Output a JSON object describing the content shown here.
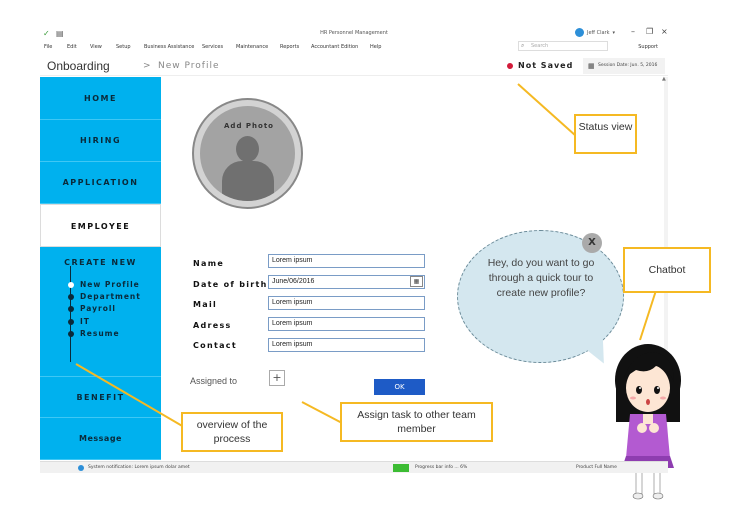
{
  "titlebar": {
    "app_title": "HR Personnel Management",
    "user_name": "Jeff Clark",
    "user_caret": "▾"
  },
  "menu": {
    "items": [
      "File",
      "Edit",
      "View",
      "Setup",
      "Business Assistance",
      "Services",
      "Maintenance",
      "Reports",
      "Accountant Edition",
      "Help"
    ],
    "search_placeholder": "Search",
    "support": "Support"
  },
  "breadcrumb": {
    "main": "Onboarding",
    "separator": ">",
    "sub": "New Profile",
    "status": "Not Saved",
    "status_color": "#d21b3a",
    "session": "Session Date: Jun. 5, 2016"
  },
  "sidebar": {
    "accent": "#00b1ee",
    "home": "HOME",
    "hiring": "HIRING",
    "application": "APPLICATION",
    "employee": "EMPLOYEE",
    "create_new": "CREATE NEW",
    "sub_items": [
      "New Profile",
      "Department",
      "Payroll",
      "IT",
      "Resume"
    ],
    "benefit": "BENEFIT",
    "message": "Message"
  },
  "form": {
    "add_photo": "Add Photo",
    "fields": [
      {
        "label": "Name",
        "value": "Lorem ipsum"
      },
      {
        "label": "Date of birth",
        "value": "June/06/2016"
      },
      {
        "label": "Mail",
        "value": "Lorem ipsum"
      },
      {
        "label": "Adress",
        "value": "Lorem ipsum"
      },
      {
        "label": "Contact",
        "value": "Lorem ipsum"
      }
    ],
    "assigned_to": "Assigned to",
    "add_symbol": "+",
    "ok": "OK"
  },
  "chatbot": {
    "message": "Hey, do you want to go through a quick tour to create new profile?",
    "close": "X"
  },
  "callouts": {
    "status_view": "Status view",
    "chatbot": "Chatbot",
    "overview": "overview of the process",
    "assign": "Assign task to other team member",
    "color": "#f5b923"
  },
  "statusbar": {
    "notification": "System notification: Lorem ipsum dolar amet",
    "progress_text": "Progress bar info ... 6%",
    "progress_color": "#3cbc33",
    "product": "Product Full Name"
  }
}
